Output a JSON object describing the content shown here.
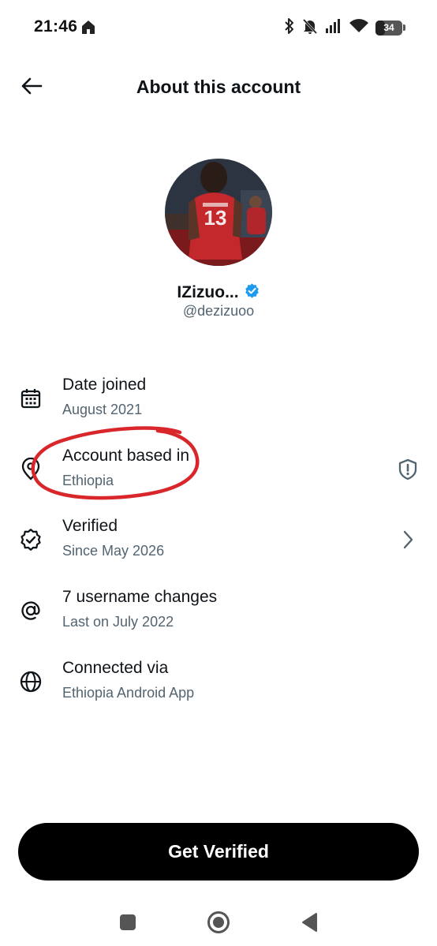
{
  "status_bar": {
    "time": "21:46",
    "battery_level": "34",
    "icons": [
      "home-icon",
      "bluetooth-icon",
      "bell-off-icon",
      "signal-icon",
      "wifi-icon",
      "battery-icon"
    ]
  },
  "header": {
    "title": "About this account",
    "back_icon": "arrow-left-icon"
  },
  "profile": {
    "name": "IZizuo...",
    "handle": "@dezizuoo",
    "verified_badge_color": "#1d9bf0",
    "jersey_number": "13"
  },
  "info": [
    {
      "icon": "calendar-icon",
      "label": "Date joined",
      "value": "August 2021"
    },
    {
      "icon": "location-pin-icon",
      "label": "Account based in",
      "value": "Ethiopia",
      "trailing_icon": "shield-alert-icon"
    },
    {
      "icon": "verified-badge-icon",
      "label": "Verified",
      "value": "Since May 2026",
      "trailing_icon": "chevron-right-icon"
    },
    {
      "icon": "at-sign-icon",
      "label": "7 username changes",
      "value": "Last on July 2022"
    },
    {
      "icon": "globe-icon",
      "label": "Connected via",
      "value": "Ethiopia Android App"
    }
  ],
  "annotation_color": "#d9262b",
  "cta": {
    "label": "Get Verified"
  },
  "nav_bar": {
    "icons": [
      "recents-square-icon",
      "home-circle-icon",
      "back-triangle-icon"
    ]
  },
  "colors": {
    "text_primary": "#0f1419",
    "text_secondary": "#536471",
    "button_bg": "#000000",
    "button_text": "#ffffff"
  }
}
